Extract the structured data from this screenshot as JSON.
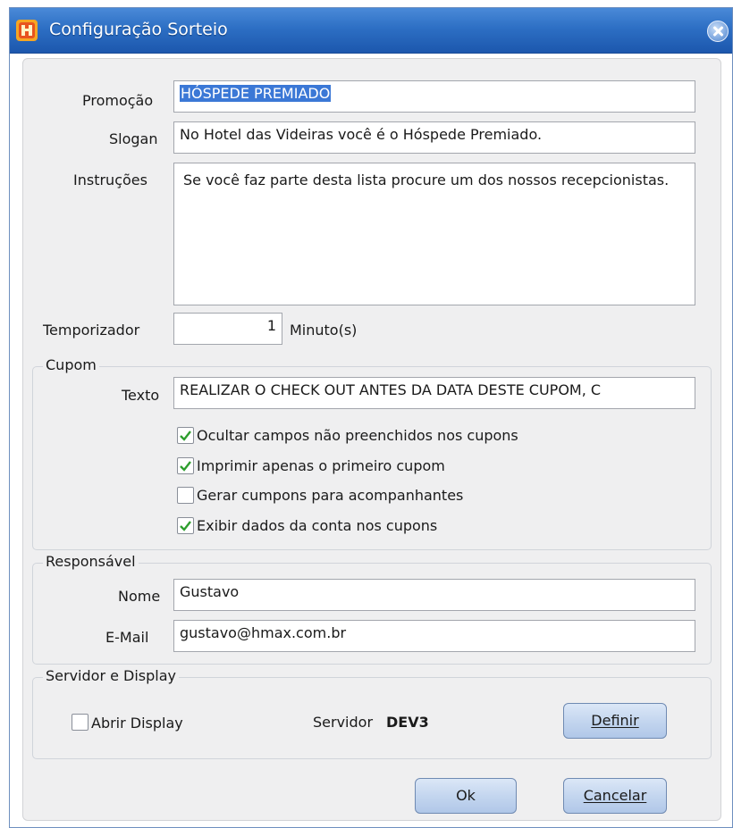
{
  "window": {
    "title": "Configuração Sorteio"
  },
  "form": {
    "promocao_label": "Promoção",
    "promocao_value": "HÓSPEDE PREMIADO",
    "slogan_label": "Slogan",
    "slogan_value": "No Hotel das Videiras você é o Hóspede Premiado.",
    "instrucoes_label": "Instruções",
    "instrucoes_value": "Se você faz parte desta lista procure um dos nossos recepcionistas.",
    "temporizador_label": "Temporizador",
    "temporizador_value": "1",
    "temporizador_unit": "Minuto(s)"
  },
  "cupom": {
    "title": "Cupom",
    "texto_label": "Texto",
    "texto_value": "REALIZAR O CHECK OUT ANTES DA DATA DESTE CUPOM, C",
    "options": [
      {
        "label": "Ocultar campos não preenchidos nos cupons",
        "checked": true
      },
      {
        "label": "Imprimir apenas o primeiro cupom",
        "checked": true
      },
      {
        "label": "Gerar cumpons para acompanhantes",
        "checked": false
      },
      {
        "label": "Exibir dados da conta nos cupons",
        "checked": true
      }
    ]
  },
  "responsavel": {
    "title": "Responsável",
    "nome_label": "Nome",
    "nome_value": "Gustavo",
    "email_label": "E-Mail",
    "email_value": "gustavo@hmax.com.br"
  },
  "servidor": {
    "title": "Servidor e Display",
    "abrir_display_label": "Abrir Display",
    "abrir_display_checked": false,
    "servidor_label": "Servidor",
    "servidor_value": "DEV3",
    "definir_label": "Definir"
  },
  "buttons": {
    "ok_label": "Ok",
    "cancelar_label": "Cancelar"
  },
  "colors": {
    "title_bar": "#2d6fc4",
    "selection": "#3b78d6",
    "check": "#2e9e2e"
  }
}
